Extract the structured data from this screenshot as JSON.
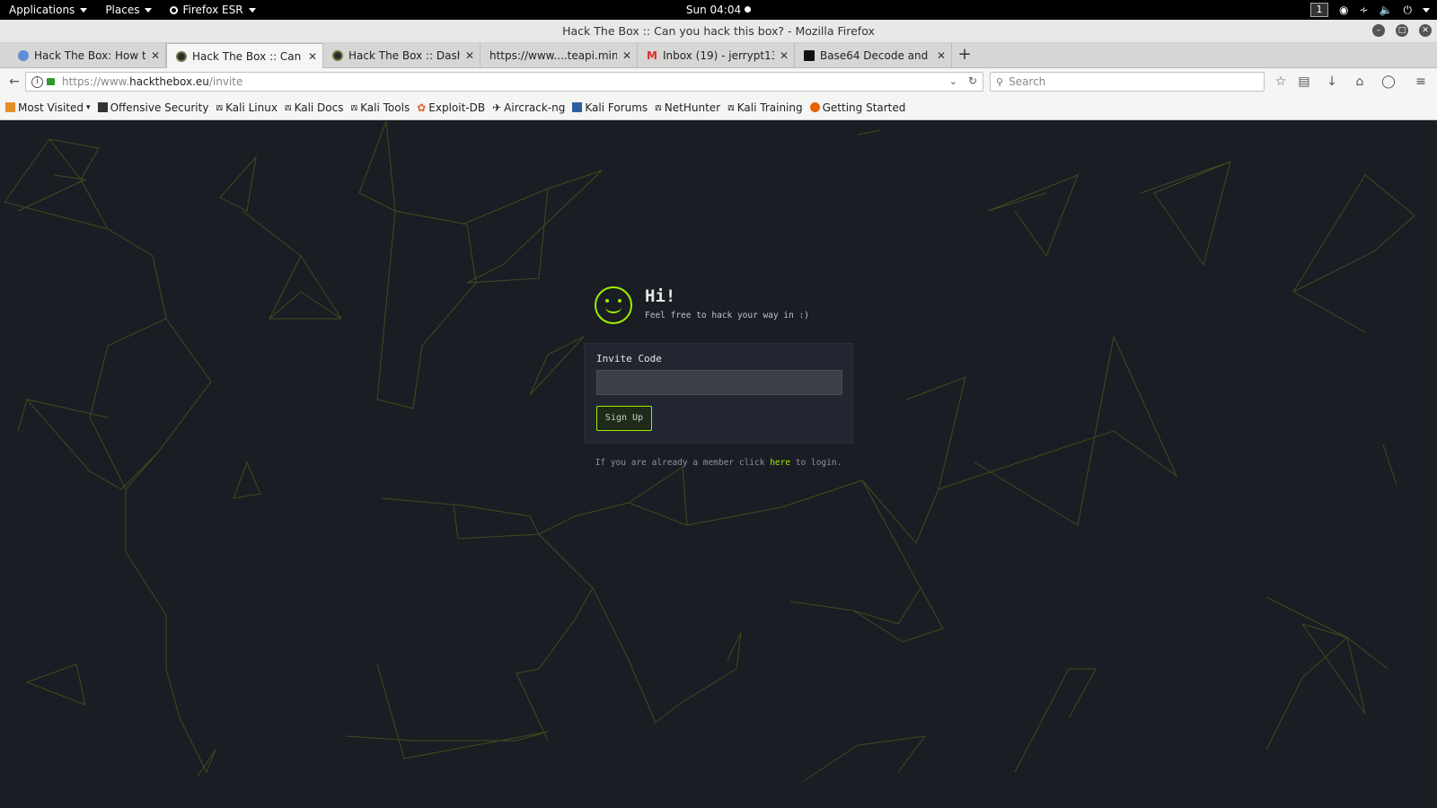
{
  "system_bar": {
    "applications": "Applications",
    "places": "Places",
    "firefox": "Firefox ESR",
    "clock": "Sun 04:04",
    "workspace": "1"
  },
  "window": {
    "title": "Hack The Box :: Can you hack this box? - Mozilla Firefox"
  },
  "tabs": [
    {
      "label": "Hack The Box: How t...",
      "fav_color": "#5b8dd9"
    },
    {
      "label": "Hack The Box :: Can y...",
      "fav_color": "#2b2b2b"
    },
    {
      "label": "Hack The Box :: Dash...",
      "fav_color": "#2b2b2b"
    },
    {
      "label": "https://www....teapi.min.js",
      "fav_color": ""
    },
    {
      "label": "Inbox (19) - jerrypt130...",
      "fav_color": "#d93025"
    },
    {
      "label": "Base64 Decode and E...",
      "fav_color": "#111111"
    }
  ],
  "nav": {
    "url_prefix": "https://www.",
    "url_host": "hackthebox.eu",
    "url_path": "/invite",
    "search_placeholder": "Search"
  },
  "bookmarks": [
    "Most Visited",
    "Offensive Security",
    "Kali Linux",
    "Kali Docs",
    "Kali Tools",
    "Exploit-DB",
    "Aircrack-ng",
    "Kali Forums",
    "NetHunter",
    "Kali Training",
    "Getting Started"
  ],
  "page": {
    "greeting": "Hi!",
    "subtitle": "Feel free to hack your way in :)",
    "invite_label": "Invite Code",
    "invite_value": "",
    "signup_label": "Sign Up",
    "login_prefix": "If you are already a member click",
    "login_link": "here",
    "login_suffix": "to login.",
    "accent": "#9fef00",
    "background": "#1a1d23"
  }
}
